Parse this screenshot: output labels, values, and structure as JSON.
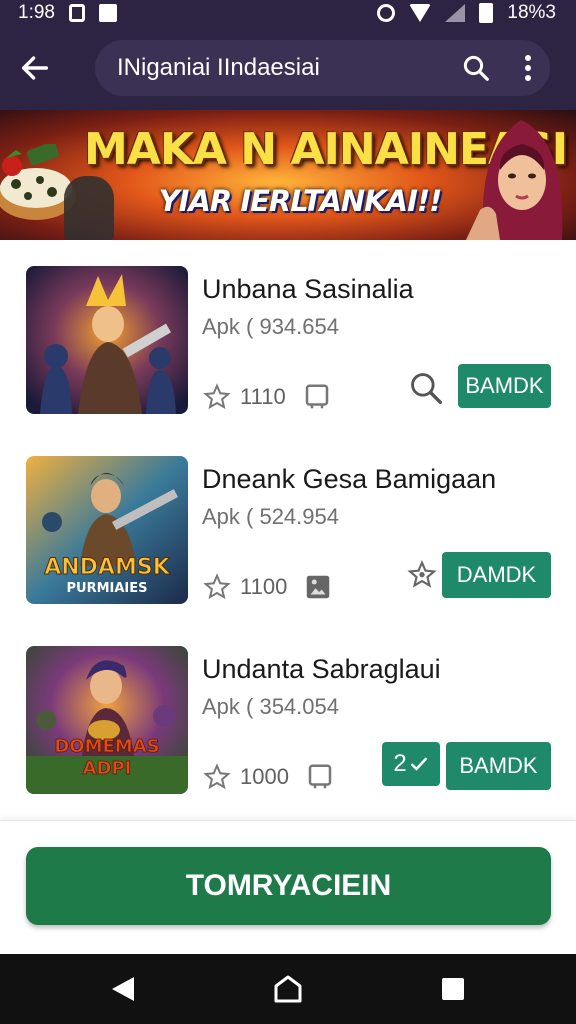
{
  "status_bar": {
    "time": "1:98",
    "battery": "18%3"
  },
  "app_bar": {
    "search_text": "INiganiai IIndaesiai"
  },
  "banner": {
    "title": "MAKA N AINAINEASI",
    "subtitle": "YIAR IERLTANKAI!!"
  },
  "apps": [
    {
      "name": "Unbana Sasinalia",
      "meta": "Apk ( 934.654",
      "rating": "1110",
      "button_label": "BAMDK",
      "icon_art_text": "",
      "colors": {
        "art_bg": "#3a2c5a",
        "art_accent": "#f0a030"
      }
    },
    {
      "name": "Dneank Gesa Bamigaan",
      "meta": "Apk ( 524.954",
      "rating": "1100",
      "button_label": "DAMDK",
      "icon_art_text": "ANDAMSK PURMIAIES",
      "colors": {
        "art_bg": "#1c4a6a",
        "art_accent": "#f5c23a"
      }
    },
    {
      "name": "Undanta Sabraglaui",
      "meta": "Apk ( 354.054",
      "rating": "1000",
      "button_label": "BAMDK",
      "badge_label": "2",
      "icon_art_text": "DOMEMAS ADPI",
      "colors": {
        "art_bg": "#2a5a3a",
        "art_accent": "#e24a1a"
      }
    }
  ],
  "primary_action": {
    "label": "TOMRYACIEIN"
  },
  "colors": {
    "app_bar": "#2d2342",
    "download_button": "#1e8a6a",
    "primary_button": "#1f7a4a"
  }
}
